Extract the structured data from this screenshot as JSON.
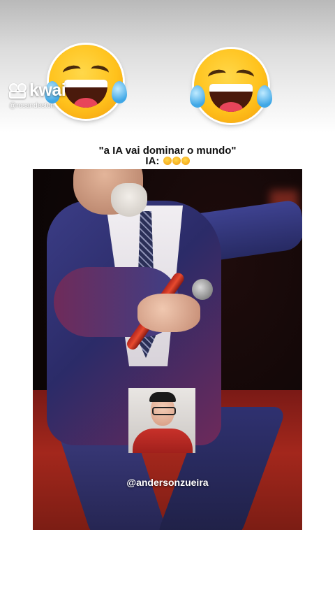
{
  "watermark": {
    "brand": "kwai",
    "handle": "@rosandeston",
    "icon": "kwai-logo-icon"
  },
  "stickers": [
    {
      "icon": "face-with-tears-of-joy-icon"
    },
    {
      "icon": "face-with-tears-of-joy-icon"
    }
  ],
  "caption": {
    "line1": "\"a IA vai dominar o mundo\"",
    "line2": "IA:"
  },
  "video": {
    "overlay_username": "@andersonzueira"
  },
  "colors": {
    "caption_text": "#111111",
    "overlay_text": "#ffffff"
  }
}
